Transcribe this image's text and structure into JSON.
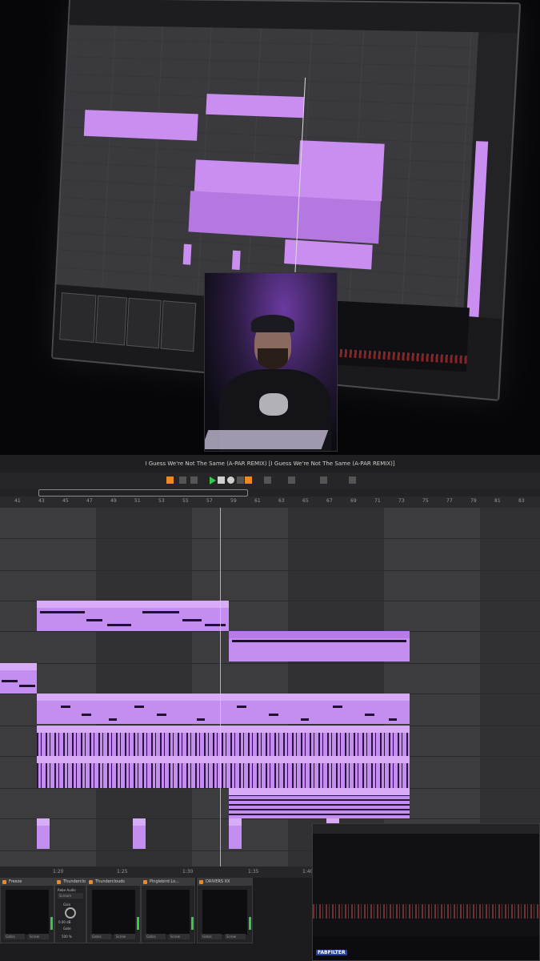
{
  "window": {
    "title": "I Guess We're Not The Same (A-PAR REMIX)  [I Guess We're Not The Same (A-PAR REMIX)]"
  },
  "ruler": {
    "bars": [
      "41",
      "43",
      "45",
      "47",
      "49",
      "51",
      "53",
      "55",
      "57",
      "59",
      "61",
      "63",
      "65",
      "67",
      "69",
      "71",
      "73",
      "75",
      "77",
      "79",
      "81",
      "83"
    ]
  },
  "timeline": {
    "labels": [
      "1:20",
      "1:25",
      "1:30",
      "1:35",
      "1:40"
    ]
  },
  "devices": [
    {
      "name": "Freeze",
      "foot_left": "Gates",
      "foot_right": "Screw"
    },
    {
      "name": "Thunderclouds",
      "top_label": "Rebe Audio",
      "select": "Scream",
      "param1": "Gain",
      "param1_value": "0.00 dB",
      "param2": "Gate",
      "param2_value": "500 %"
    },
    {
      "name": "Thunderclouds",
      "foot_left": "Gates",
      "foot_right": "Screw"
    },
    {
      "name": "Pinglebird Lo...",
      "foot_left": "Gates",
      "foot_right": "Screw"
    },
    {
      "name": "DRIVERS XX",
      "foot_left": "Gates",
      "foot_right": "Screw"
    }
  ],
  "spectrum": {
    "logo": "FABFILTER"
  },
  "colors": {
    "clip": "#c48ef0",
    "clip_header": "#d7abf6",
    "accent": "#ee8a1d",
    "play": "#36c94b"
  }
}
